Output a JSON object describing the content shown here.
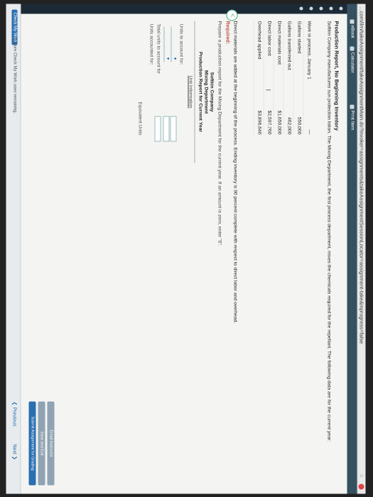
{
  "browser": {
    "url": "...com/ilrn/takeAssignment/takeAssignmentMain.do?invoker=assignments&takeAssignmentSessionLocator=assignment-take&inprogress=false"
  },
  "toolbar": {
    "ebook_label": "eBook",
    "calculator_label": "Calculator",
    "print_label": "Print Item"
  },
  "problem": {
    "title": "Production Report, No Beginning Inventory",
    "intro": "Softkin Company manufactures sun protection lotion. The Mixing Department, the first process department, mixes the chemicals required for the repellant. The following data are for the current year:",
    "rows": [
      {
        "label": "Work in process, January 1",
        "value": "—"
      },
      {
        "label": "Gallons started",
        "value": "550,000"
      },
      {
        "label": "Gallons transferred out",
        "value": "462,000"
      },
      {
        "label": "Direct materials cost",
        "value": "$1,650,000"
      },
      {
        "label": "Direct labor cost",
        "value": "$2,597,760"
      },
      {
        "label": "Overhead applied",
        "value": "$3,896,640"
      }
    ],
    "after_table": "Direct materials are added at the beginning of the process. Ending inventory is 90 percent complete with respect to direct labor and overhead.",
    "required_label": "Required:",
    "prepare_text": "Prepare a production report for the Mixing Department for the current year. If an amount is zero, enter \"0\"."
  },
  "report": {
    "company": "Softkin Company",
    "department": "Mixing Department",
    "title": "Production Report for Current Year",
    "unit_info": "Unit Information",
    "units_to_account_label": "Units to account for:",
    "total_units_label": "Total units to account for",
    "units_accounted_label": "Units accounted for:",
    "equivalent_units_label": "Equivalent Units"
  },
  "footer": {
    "check_label": "Check My Work",
    "remaining_text": "3 more Check My Work uses remaining.",
    "previous_label": "Previous",
    "next_label": "Next",
    "email_label": "Email Instructor",
    "save_label": "Save and Exit",
    "submit_label": "Submit Assignment for Grading"
  }
}
